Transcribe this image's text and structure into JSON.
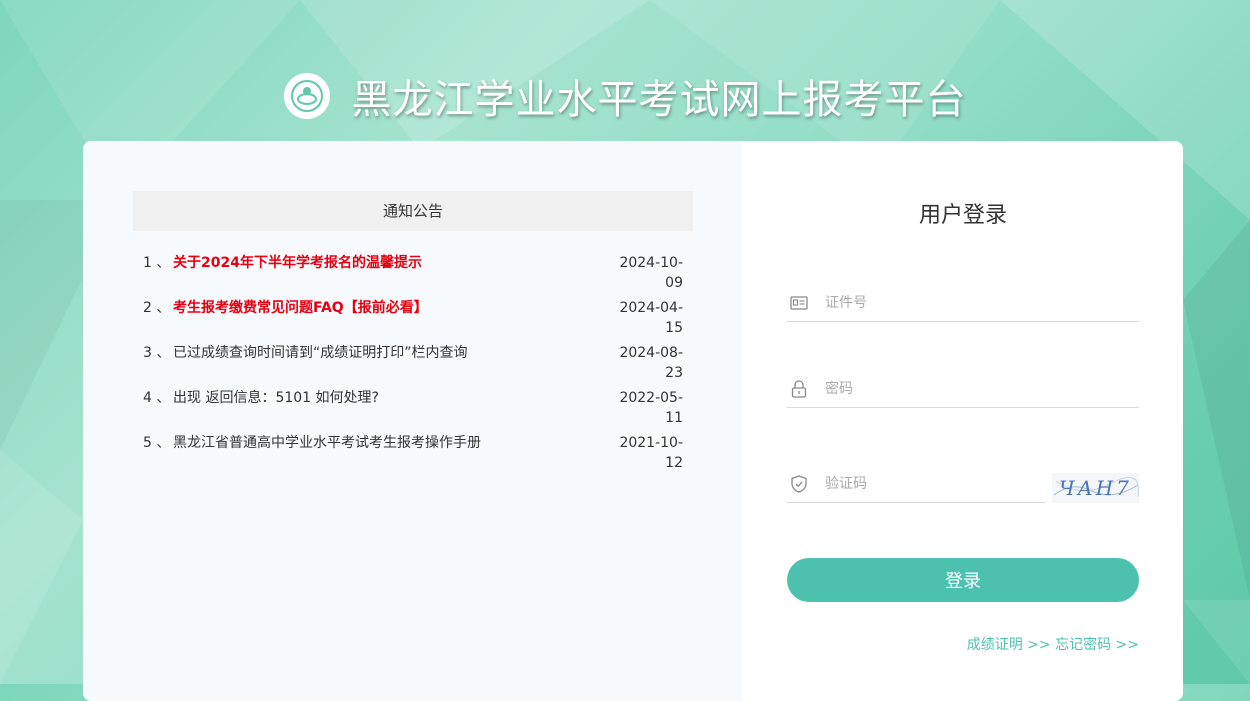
{
  "site": {
    "title": "黑龙江学业水平考试网上报考平台"
  },
  "notice": {
    "heading": "通知公告",
    "items": [
      {
        "index": "1 、",
        "text": "关于2024年下半年学考报名的温馨提示",
        "date": "2024-10-09",
        "highlight": true
      },
      {
        "index": "2 、",
        "text": "考生报考缴费常见问题FAQ【报前必看】",
        "date": "2024-04-15",
        "highlight": true
      },
      {
        "index": "3 、",
        "text": "已过成绩查询时间请到“成绩证明打印”栏内查询",
        "date": "2024-08-23",
        "highlight": false
      },
      {
        "index": "4 、",
        "text": "出现 返回信息：5101 如何处理?",
        "date": "2022-05-11",
        "highlight": false
      },
      {
        "index": "5 、",
        "text": "黑龙江省普通高中学业水平考试考生报考操作手册",
        "date": "2021-10-12",
        "highlight": false
      }
    ]
  },
  "login": {
    "title": "用户登录",
    "id_placeholder": "证件号",
    "password_placeholder": "密码",
    "captcha_placeholder": "验证码",
    "captcha_text": "ЧАН7",
    "submit_label": "登录",
    "score_link": "成绩证明 >>",
    "forgot_link": "忘记密码 >>"
  },
  "colors": {
    "accent": "#4cc2ae",
    "hot": "#e60012"
  },
  "icons": {
    "id": "id-card-icon",
    "password": "lock-icon",
    "captcha": "shield-icon"
  }
}
